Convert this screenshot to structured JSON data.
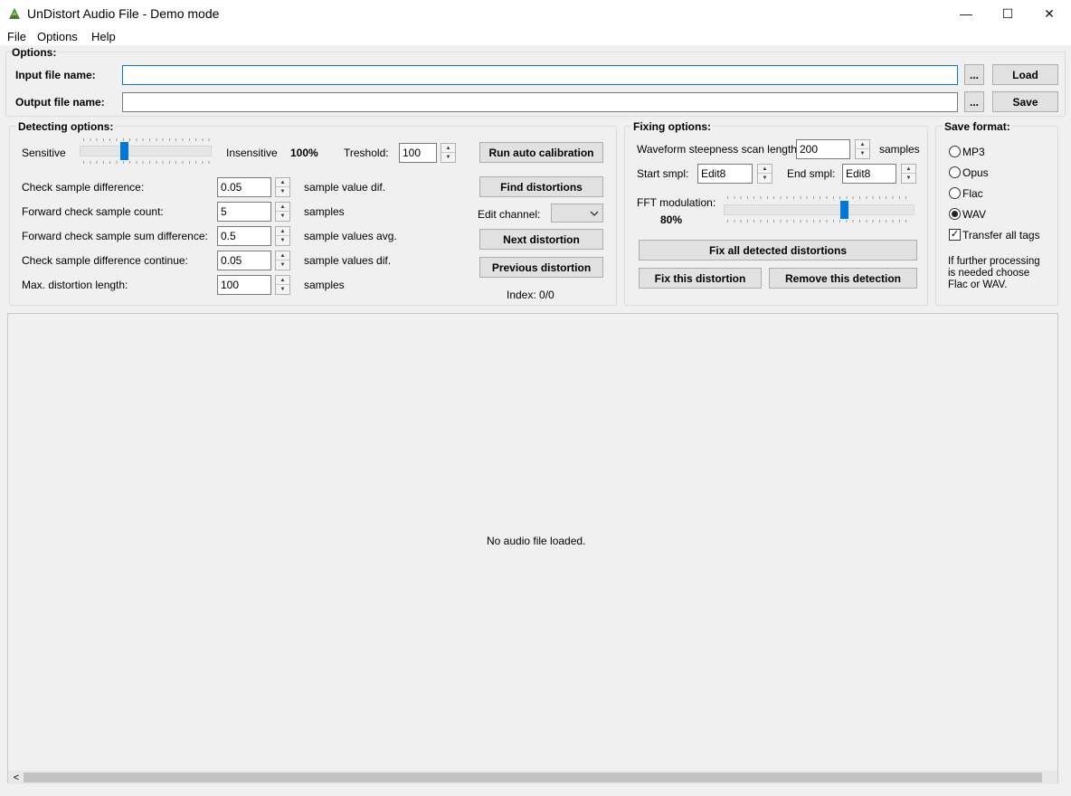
{
  "window": {
    "title": "UnDistort Audio File - Demo mode",
    "minimize": "—",
    "maximize": "☐",
    "close": "✕"
  },
  "menu": {
    "file": "File",
    "options": "Options",
    "help": "Help"
  },
  "options_group": {
    "title": "Options:",
    "input_label": "Input file name:",
    "input_value": "",
    "output_label": "Output file name:",
    "output_value": "",
    "browse_label": "...",
    "load_label": "Load",
    "save_label": "Save"
  },
  "detecting": {
    "title": "Detecting options:",
    "sensitive_label": "Sensitive",
    "insensitive_label": "Insensitive",
    "sensitivity_value": "100%",
    "treshold_label": "Treshold:",
    "treshold_value": "100",
    "rows": [
      {
        "label": "Check sample difference:",
        "value": "0.05",
        "unit": "sample value dif."
      },
      {
        "label": "Forward check sample count:",
        "value": "5",
        "unit": "samples"
      },
      {
        "label": "Forward check sample sum difference:",
        "value": "0.5",
        "unit": "sample values avg."
      },
      {
        "label": "Check sample difference continue:",
        "value": "0.05",
        "unit": "sample values dif."
      },
      {
        "label": "Max. distortion length:",
        "value": "100",
        "unit": "samples"
      }
    ],
    "run_auto_calibration": "Run auto calibration",
    "find_distortions": "Find distortions",
    "edit_channel_label": "Edit channel:",
    "edit_channel_value": "",
    "next_distortion": "Next distortion",
    "previous_distortion": "Previous distortion",
    "index_text": "Index: 0/0"
  },
  "fixing": {
    "title": "Fixing options:",
    "steepness_label": "Waveform steepness scan length:",
    "steepness_value": "200",
    "steepness_unit": "samples",
    "start_label": "Start smpl:",
    "start_value": "Edit8",
    "end_label": "End smpl:",
    "end_value": "Edit8",
    "fft_label": "FFT modulation:",
    "fft_value": "80%",
    "fix_all": "Fix all detected distortions",
    "fix_this": "Fix this distortion",
    "remove_detection": "Remove this detection"
  },
  "save_format": {
    "title": "Save format:",
    "options": [
      "MP3",
      "Opus",
      "Flac",
      "WAV"
    ],
    "selected": "WAV",
    "transfer_tags_label": "Transfer all tags",
    "transfer_tags_checked": true,
    "check_mark": "✓",
    "note": "If further processing is needed choose Flac or WAV."
  },
  "waveform": {
    "empty_text": "No audio file loaded.",
    "scroll_left": "<"
  },
  "icons": {
    "app": "app-logo-icon",
    "spin_up": "▲",
    "spin_down": "▼",
    "combo_arrow": "chevron-down-icon"
  }
}
